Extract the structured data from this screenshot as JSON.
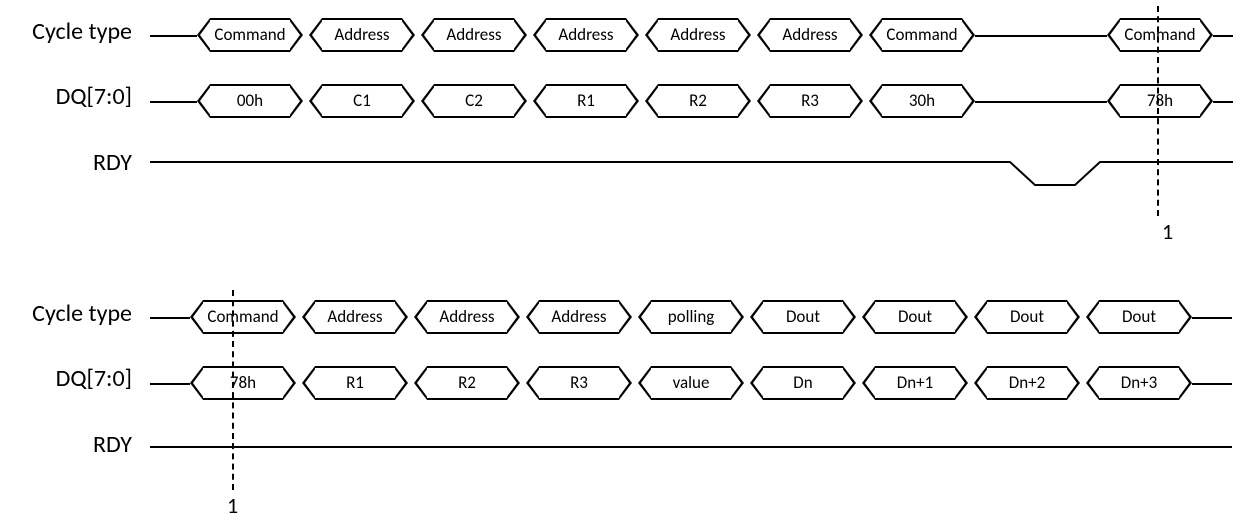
{
  "chart_data": {
    "type": "timing-diagram",
    "markers": [
      {
        "id": "1",
        "description": "continuation point between the two timing segments (command 78h)"
      }
    ],
    "segments": [
      {
        "rows": [
          {
            "signal": "Cycle type",
            "values": [
              "Command",
              "Address",
              "Address",
              "Address",
              "Address",
              "Address",
              "Command",
              "Command"
            ],
            "gap_after_index": 6
          },
          {
            "signal": "DQ[7:0]",
            "values": [
              "00h",
              "C1",
              "C2",
              "R1",
              "R2",
              "R3",
              "30h",
              "78h"
            ],
            "gap_after_index": 6
          },
          {
            "signal": "RDY",
            "type": "line",
            "description": "High until after 30h command, pulses low, returns high before 78h"
          }
        ]
      },
      {
        "rows": [
          {
            "signal": "Cycle type",
            "values": [
              "Command",
              "Address",
              "Address",
              "Address",
              "polling",
              "Dout",
              "Dout",
              "Dout",
              "Dout"
            ]
          },
          {
            "signal": "DQ[7:0]",
            "values": [
              "78h",
              "R1",
              "R2",
              "R3",
              "value",
              "Dn",
              "Dn+1",
              "Dn+2",
              "Dn+3"
            ]
          },
          {
            "signal": "RDY",
            "type": "line",
            "description": "High throughout"
          }
        ]
      }
    ]
  },
  "labels": {
    "cycle_type": "Cycle type",
    "dq": "DQ[7:0]",
    "rdy": "RDY",
    "marker1": "1"
  },
  "seg1": {
    "cycle": {
      "c0": "Command",
      "c1": "Address",
      "c2": "Address",
      "c3": "Address",
      "c4": "Address",
      "c5": "Address",
      "c6": "Command",
      "c7": "Command"
    },
    "dq": {
      "d0": "00h",
      "d1": "C1",
      "d2": "C2",
      "d3": "R1",
      "d4": "R2",
      "d5": "R3",
      "d6": "30h",
      "d7": "78h"
    }
  },
  "seg2": {
    "cycle": {
      "c0": "Command",
      "c1": "Address",
      "c2": "Address",
      "c3": "Address",
      "c4": "polling",
      "c5": "Dout",
      "c6": "Dout",
      "c7": "Dout",
      "c8": "Dout"
    },
    "dq": {
      "d0": "78h",
      "d1": "R1",
      "d2": "R2",
      "d3": "R3",
      "d4": "value",
      "d5": "Dn",
      "d6": "Dn+1",
      "d7": "Dn+2",
      "d8": "Dn+3"
    }
  }
}
